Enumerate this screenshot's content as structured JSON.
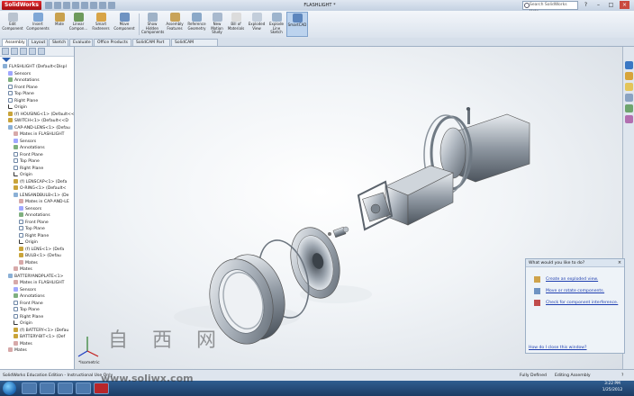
{
  "app": {
    "logo": "SolidWorks",
    "doc_title": "FLASHLIGHT *"
  },
  "search": {
    "placeholder": "Search SolidWorks Help"
  },
  "window_controls": [
    "?",
    "–",
    "□",
    "×"
  ],
  "ribbon": [
    {
      "label": "Edit\nComponent",
      "icon": "edit-component-icon"
    },
    {
      "label": "Insert\nComponents",
      "icon": "insert-components-icon"
    },
    {
      "label": "Mate",
      "icon": "mate-icon"
    },
    {
      "label": "Linear\nCompon...",
      "icon": "linear-pattern-icon"
    },
    {
      "label": "Smart\nFasteners",
      "icon": "smart-fasteners-icon"
    },
    {
      "label": "Move\nComponent",
      "icon": "move-component-icon"
    },
    {
      "label": "Show\nHidden\nComponents",
      "icon": "show-hidden-icon"
    },
    {
      "label": "Assembly\nFeatures",
      "icon": "assembly-features-icon"
    },
    {
      "label": "Reference\nGeometry",
      "icon": "reference-geometry-icon"
    },
    {
      "label": "New\nMotion\nStudy",
      "icon": "motion-study-icon"
    },
    {
      "label": "Bill of\nMaterials",
      "icon": "bom-icon"
    },
    {
      "label": "Exploded\nView",
      "icon": "exploded-view-icon"
    },
    {
      "label": "Explode\nLine\nSketch",
      "icon": "explode-line-icon"
    },
    {
      "label": "SmartCAD",
      "icon": "smartcad-icon"
    }
  ],
  "tabs": [
    "Assembly",
    "Layout",
    "Sketch",
    "Evaluate",
    "Office Products",
    "SolidCAM Part",
    "SolidCAM Operations"
  ],
  "tree": [
    {
      "label": "FLASHLIGHT  (Default<Displ",
      "indent": 0,
      "icon": "asm"
    },
    {
      "label": "Sensors",
      "indent": 1,
      "icon": "sens"
    },
    {
      "label": "Annotations",
      "indent": 1,
      "icon": "note"
    },
    {
      "label": "Front Plane",
      "indent": 1,
      "icon": "plane"
    },
    {
      "label": "Top Plane",
      "indent": 1,
      "icon": "plane"
    },
    {
      "label": "Right Plane",
      "indent": 1,
      "icon": "plane"
    },
    {
      "label": "Origin",
      "indent": 1,
      "icon": "origin"
    },
    {
      "label": "(f) HOUSING<1> (Default<<",
      "indent": 1,
      "icon": "part"
    },
    {
      "label": "SWITCH<1> (Default<<D",
      "indent": 1,
      "icon": "part"
    },
    {
      "label": "CAP-AND-LENS<1> (Defau",
      "indent": 1,
      "icon": "asm"
    },
    {
      "label": "Mates in FLASHLIGHT",
      "indent": 2,
      "icon": "mate"
    },
    {
      "label": "Sensors",
      "indent": 2,
      "icon": "sens"
    },
    {
      "label": "Annotations",
      "indent": 2,
      "icon": "note"
    },
    {
      "label": "Front Plane",
      "indent": 2,
      "icon": "plane"
    },
    {
      "label": "Top Plane",
      "indent": 2,
      "icon": "plane"
    },
    {
      "label": "Right Plane",
      "indent": 2,
      "icon": "plane"
    },
    {
      "label": "Origin",
      "indent": 2,
      "icon": "origin"
    },
    {
      "label": "(f) LENSCAP<1> (Defa",
      "indent": 2,
      "icon": "part"
    },
    {
      "label": "O-RING<1> (Default<",
      "indent": 2,
      "icon": "part"
    },
    {
      "label": "LENSANDBULB<1> (De",
      "indent": 2,
      "icon": "asm"
    },
    {
      "label": "Mates in CAP-AND-LE",
      "indent": 3,
      "icon": "mate"
    },
    {
      "label": "Sensors",
      "indent": 3,
      "icon": "sens"
    },
    {
      "label": "Annotations",
      "indent": 3,
      "icon": "note"
    },
    {
      "label": "Front Plane",
      "indent": 3,
      "icon": "plane"
    },
    {
      "label": "Top Plane",
      "indent": 3,
      "icon": "plane"
    },
    {
      "label": "Right Plane",
      "indent": 3,
      "icon": "plane"
    },
    {
      "label": "Origin",
      "indent": 3,
      "icon": "origin"
    },
    {
      "label": "(f) LENS<1> (Defa",
      "indent": 3,
      "icon": "part"
    },
    {
      "label": "BULB<1> (Defau",
      "indent": 3,
      "icon": "part"
    },
    {
      "label": "Mates",
      "indent": 3,
      "icon": "mate"
    },
    {
      "label": "Mates",
      "indent": 2,
      "icon": "mate"
    },
    {
      "label": "BATTERYANDPLATE<1>",
      "indent": 1,
      "icon": "asm"
    },
    {
      "label": "Mates in FLASHLIGHT",
      "indent": 2,
      "icon": "mate"
    },
    {
      "label": "Sensors",
      "indent": 2,
      "icon": "sens"
    },
    {
      "label": "Annotations",
      "indent": 2,
      "icon": "note"
    },
    {
      "label": "Front Plane",
      "indent": 2,
      "icon": "plane"
    },
    {
      "label": "Top Plane",
      "indent": 2,
      "icon": "plane"
    },
    {
      "label": "Right Plane",
      "indent": 2,
      "icon": "plane"
    },
    {
      "label": "Origin",
      "indent": 2,
      "icon": "origin"
    },
    {
      "label": "(f) BATTERY<1> (Defau",
      "indent": 2,
      "icon": "part"
    },
    {
      "label": "BATTERY-BIT<1> (Def",
      "indent": 2,
      "icon": "part"
    },
    {
      "label": "Mates",
      "indent": 2,
      "icon": "mate"
    },
    {
      "label": "Mates",
      "indent": 1,
      "icon": "mate"
    }
  ],
  "taskpane": {
    "header": "What would you like to do?",
    "links": [
      "Create an exploded view.",
      "Move or rotate components.",
      "Check for component interference."
    ],
    "footer": "How do I close this window?"
  },
  "viewport": {
    "view_label": "*Isometric"
  },
  "status": {
    "left": "SolidWorks Education Edition - Instructional Use Only",
    "fully_defined": "Fully Defined",
    "mode": "Editing Assembly",
    "help": "?"
  },
  "clock": {
    "time": "3:22 PM",
    "date": "1/25/2012"
  },
  "watermark": {
    "chars": "自 西 网",
    "url": "www.soliwx.com"
  },
  "colors": {
    "accent": "#1c3c64",
    "brand_red": "#c5161b",
    "link": "#1f3fb0"
  }
}
